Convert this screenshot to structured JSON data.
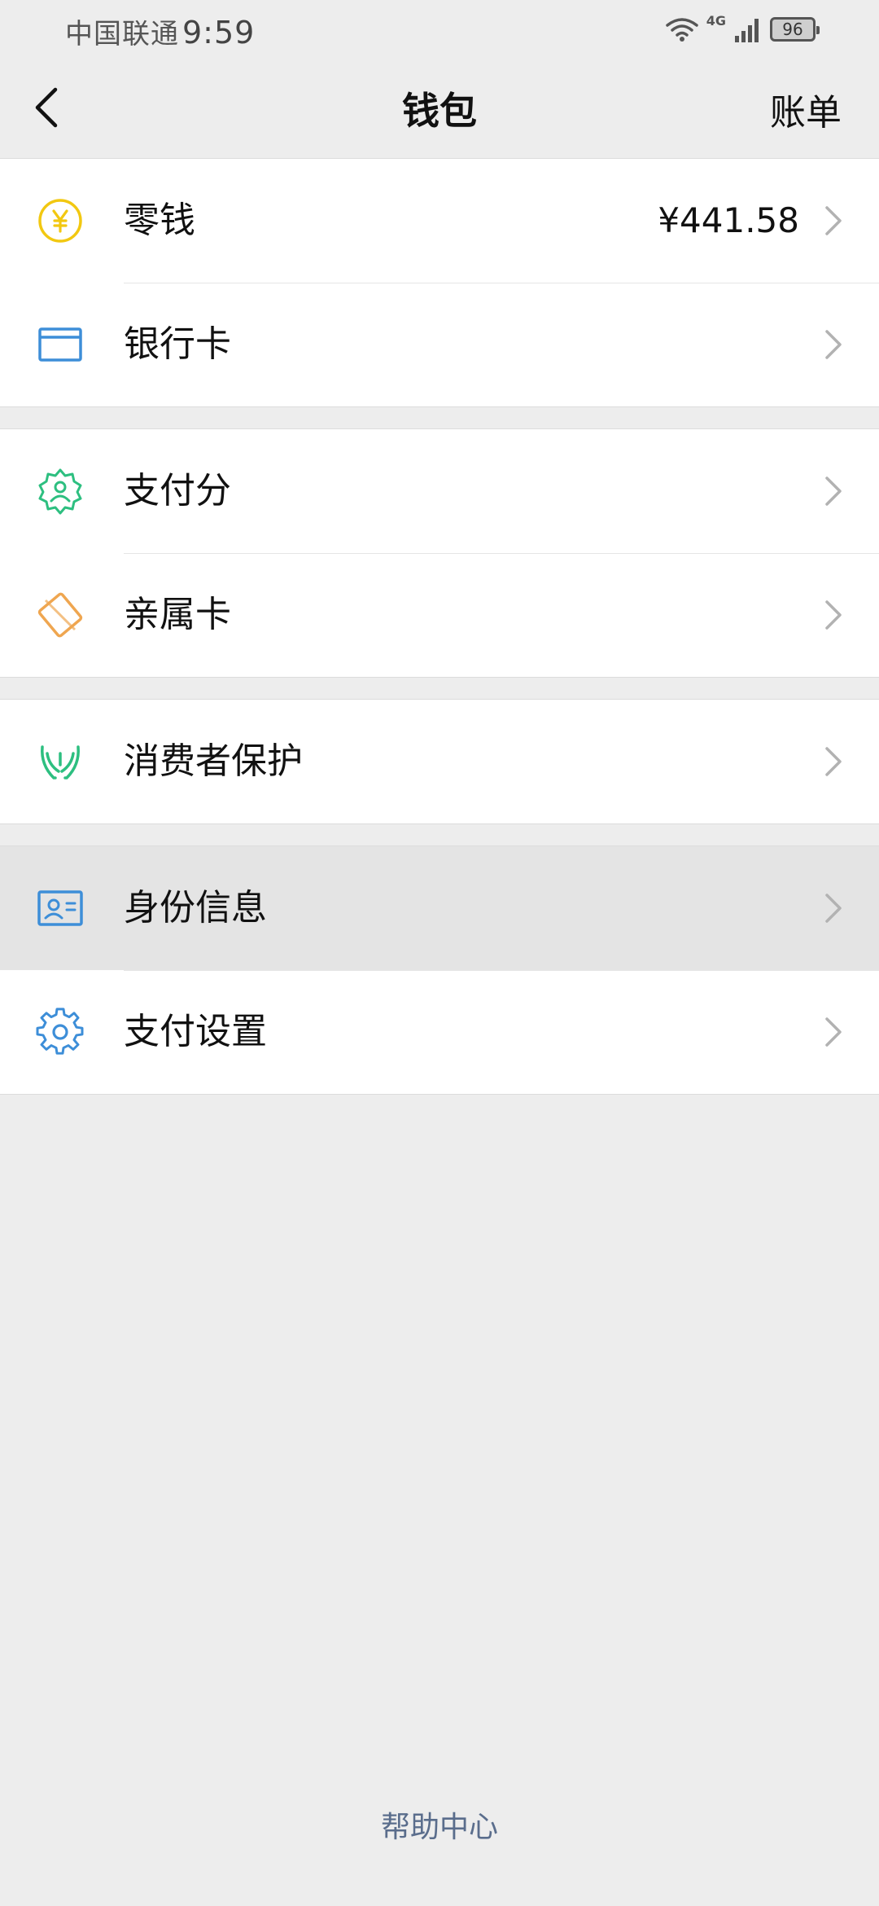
{
  "status_bar": {
    "carrier": "中国联通",
    "time": "9:59",
    "network": "4G",
    "battery": "96"
  },
  "nav": {
    "title": "钱包",
    "action": "账单"
  },
  "groups": [
    {
      "items": [
        {
          "label": "零钱",
          "value": "¥441.58",
          "icon": "coin-icon",
          "icon_color": "#f2c811"
        },
        {
          "label": "银行卡",
          "icon": "bank-card-icon",
          "icon_color": "#3d8ed8"
        }
      ]
    },
    {
      "items": [
        {
          "label": "支付分",
          "icon": "pay-score-badge-icon",
          "icon_color": "#2dbf80"
        },
        {
          "label": "亲属卡",
          "icon": "family-card-icon",
          "icon_color": "#efa650"
        }
      ]
    },
    {
      "items": [
        {
          "label": "消费者保护",
          "icon": "protect-hands-icon",
          "icon_color": "#2dbf80"
        }
      ]
    },
    {
      "items": [
        {
          "label": "身份信息",
          "icon": "id-card-icon",
          "icon_color": "#3d8ed8"
        },
        {
          "label": "支付设置",
          "icon": "gear-icon",
          "icon_color": "#3d8ed8"
        }
      ]
    }
  ],
  "footer": {
    "help_label": "帮助中心"
  },
  "colors": {
    "background": "#ededed",
    "card": "#ffffff",
    "link": "#5a6d8c",
    "chevron": "#b2b2b2"
  }
}
